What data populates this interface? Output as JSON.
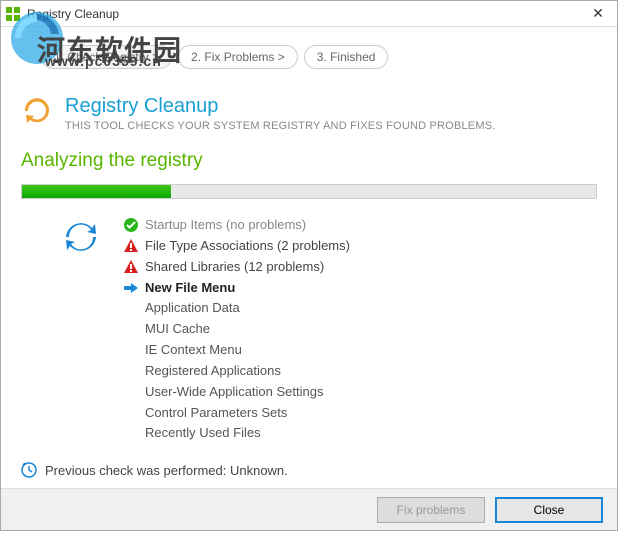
{
  "window": {
    "title": "Registry Cleanup"
  },
  "watermark": {
    "text": "河东软件园",
    "url": "www.pc0359.cn"
  },
  "steps": [
    "1. Check Registry >",
    "2. Fix Problems >",
    "3. Finished"
  ],
  "header": {
    "title": "Registry Cleanup",
    "subtitle": "THIS TOOL CHECKS YOUR SYSTEM REGISTRY AND FIXES FOUND PROBLEMS."
  },
  "status": {
    "title": "Analyzing the registry",
    "progress_percent": 26
  },
  "items": [
    {
      "status": "ok",
      "label": "Startup Items (no problems)"
    },
    {
      "status": "warn",
      "label": "File Type Associations (2 problems)"
    },
    {
      "status": "warn",
      "label": "Shared Libraries (12 problems)"
    },
    {
      "status": "current",
      "label": "New File Menu"
    },
    {
      "status": "pending",
      "label": "Application Data"
    },
    {
      "status": "pending",
      "label": "MUI Cache"
    },
    {
      "status": "pending",
      "label": "IE Context Menu"
    },
    {
      "status": "pending",
      "label": "Registered Applications"
    },
    {
      "status": "pending",
      "label": "User-Wide Application Settings"
    },
    {
      "status": "pending",
      "label": "Control Parameters Sets"
    },
    {
      "status": "pending",
      "label": "Recently Used Files"
    }
  ],
  "previous_check": "Previous check was performed: Unknown.",
  "footer": {
    "fix_button": "Fix problems",
    "close_button": "Close"
  }
}
